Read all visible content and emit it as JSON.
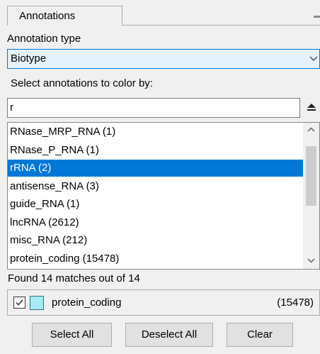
{
  "panel": {
    "tab_title": "Annotations"
  },
  "annotation_type": {
    "label": "Annotation type",
    "selected": "Biotype"
  },
  "search": {
    "label": "Select annotations to color by:",
    "value": "r"
  },
  "list": {
    "items": [
      {
        "label": "RNase_MRP_RNA (1)",
        "selected": false
      },
      {
        "label": "RNase_P_RNA (1)",
        "selected": false
      },
      {
        "label": "rRNA (2)",
        "selected": true
      },
      {
        "label": "antisense_RNA (3)",
        "selected": false
      },
      {
        "label": "guide_RNA (1)",
        "selected": false
      },
      {
        "label": "lncRNA (2612)",
        "selected": false
      },
      {
        "label": "misc_RNA (212)",
        "selected": false
      },
      {
        "label": "protein_coding (15478)",
        "selected": false
      }
    ],
    "scroll_position": 0.14
  },
  "status": {
    "found_text": "Found 14 matches out of 14"
  },
  "selected_annotations": [
    {
      "name": "protein_coding",
      "count": "(15478)",
      "checked": true,
      "color": "#a6ebf5"
    }
  ],
  "buttons": {
    "select_all": "Select All",
    "deselect_all": "Deselect All",
    "clear": "Clear"
  },
  "colors": {
    "accent": "#0078d7",
    "combo_bg": "#e5f1fb",
    "swatch": "#a6ebf5"
  }
}
